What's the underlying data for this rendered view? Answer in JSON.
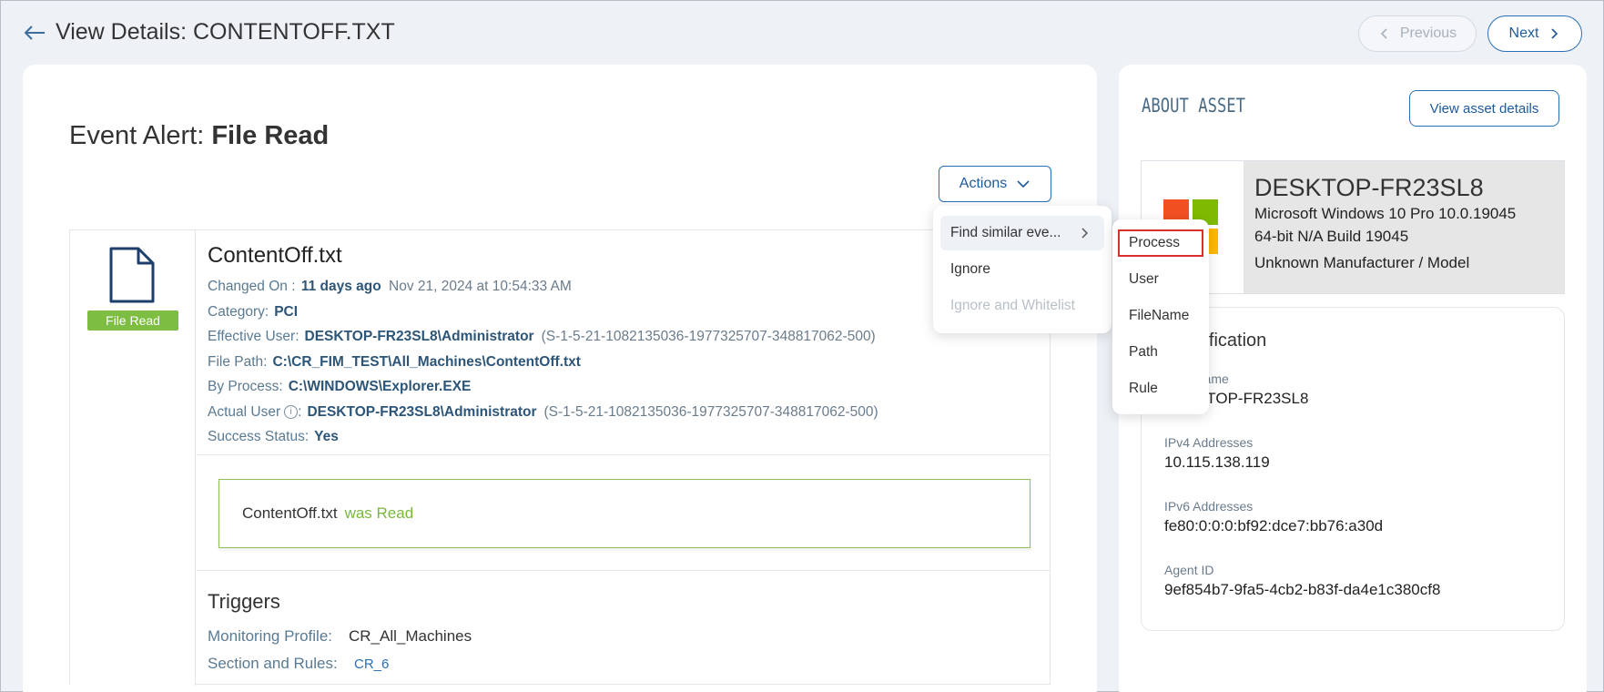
{
  "header": {
    "title": "View Details: CONTENTOFF.TXT",
    "prev_label": "Previous",
    "next_label": "Next"
  },
  "event": {
    "title_prefix": "Event Alert:",
    "title_value": "File Read",
    "actions_label": "Actions",
    "badge": "File Read",
    "file_name": "ContentOff.txt",
    "changed_on_label": "Changed On :",
    "changed_on_relative": "11 days ago",
    "changed_on_date": "Nov 21, 2024 at 10:54:33 AM",
    "category_label": "Category:",
    "category_value": "PCI",
    "effective_user_label": "Effective User:",
    "effective_user_value": "DESKTOP-FR23SL8\\Administrator",
    "effective_user_sid": "(S-1-5-21-1082135036-1977325707-348817062-500)",
    "file_path_label": "File Path:",
    "file_path_value": "C:\\CR_FIM_TEST\\All_Machines\\ContentOff.txt",
    "by_process_label": "By Process:",
    "by_process_value": "C:\\WINDOWS\\Explorer.EXE",
    "actual_user_label": "Actual User",
    "actual_user_value": "DESKTOP-FR23SL8\\Administrator",
    "actual_user_sid": "(S-1-5-21-1082135036-1977325707-348817062-500)",
    "success_label": "Success Status:",
    "success_value": "Yes",
    "read_file": "ContentOff.txt",
    "read_action": "was Read"
  },
  "triggers": {
    "title": "Triggers",
    "monitoring_profile_label": "Monitoring Profile:",
    "monitoring_profile_value": "CR_All_Machines",
    "section_rules_label": "Section and Rules:",
    "section_rules_value": "CR_6"
  },
  "asset": {
    "section_title": "ABOUT ASSET",
    "view_details_label": "View asset details",
    "name": "DESKTOP-FR23SL8",
    "os": "Microsoft Windows 10 Pro 10.0.19045",
    "build": "64-bit N/A Build 19045",
    "manufacturer": "Unknown Manufacturer / Model",
    "identification_title": "Identification",
    "dns_label": "DNS Name",
    "dns_value": "DESKTOP-FR23SL8",
    "ipv4_label": "IPv4 Addresses",
    "ipv4_value": "10.115.138.119",
    "ipv6_label": "IPv6 Addresses",
    "ipv6_value": "fe80:0:0:0:bf92:dce7:bb76:a30d",
    "agent_label": "Agent ID",
    "agent_value": "9ef854b7-9fa5-4cb2-b83f-da4e1c380cf8"
  },
  "actions_menu": {
    "items": [
      "Find similar eve...",
      "Ignore",
      "Ignore and Whitelist"
    ]
  },
  "similar_menu": {
    "items": [
      "Process",
      "User",
      "FileName",
      "Path",
      "Rule"
    ]
  },
  "colors": {
    "accent": "#2a6fb5",
    "success_green": "#7dbd42",
    "selection_red": "#d9302c"
  }
}
